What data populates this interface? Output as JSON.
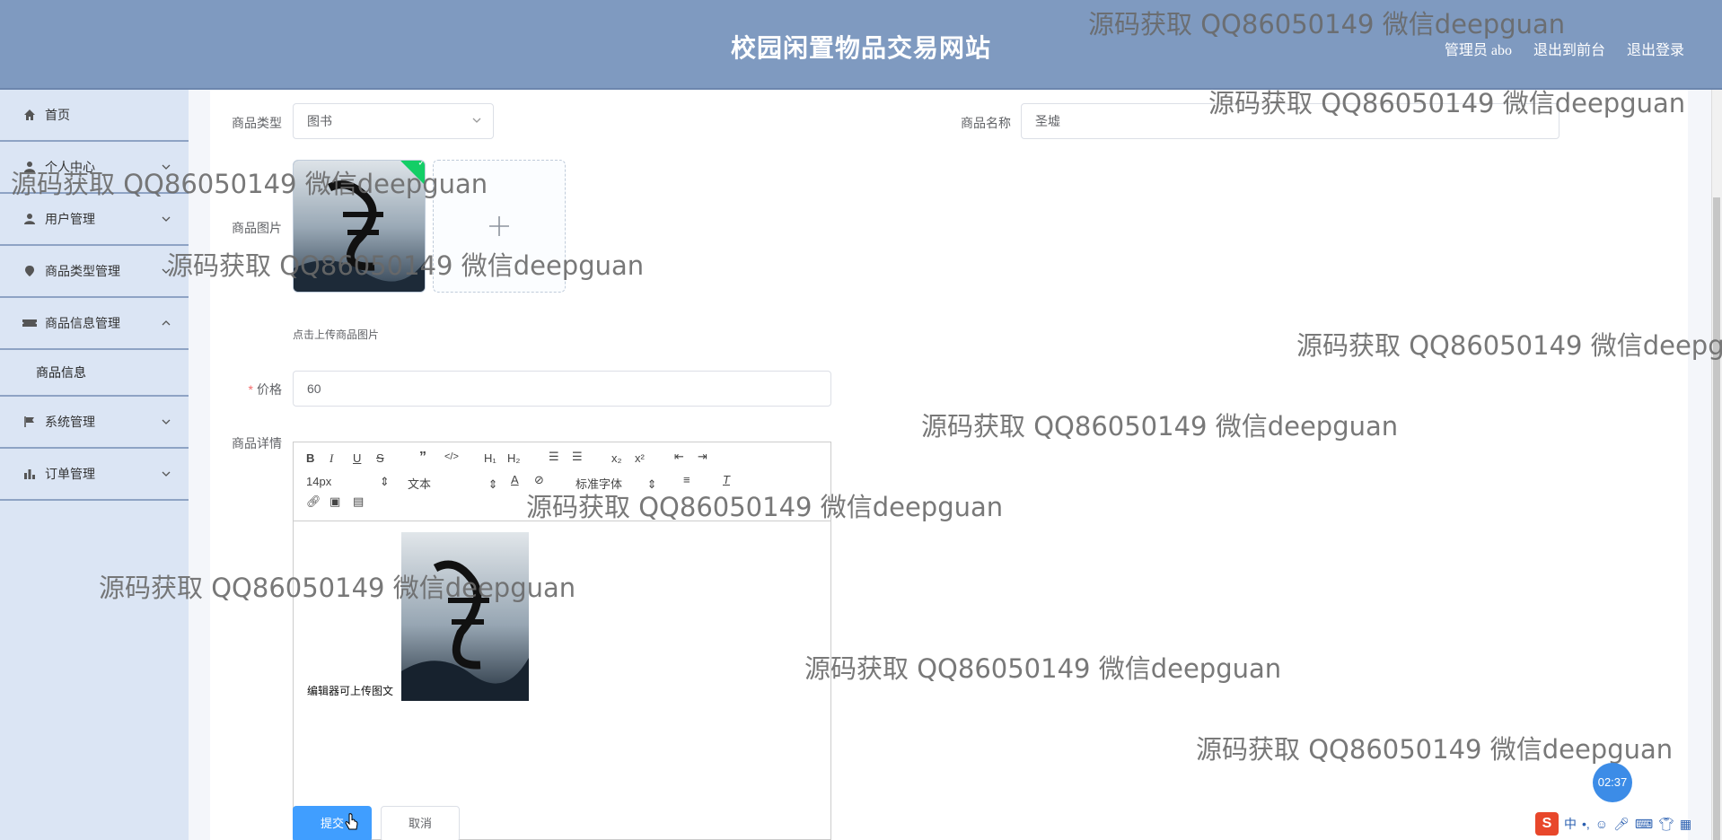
{
  "header": {
    "title": "校园闲置物品交易网站",
    "admin": "管理员 abo",
    "to_front": "退出到前台",
    "logout": "退出登录"
  },
  "sidebar": {
    "items": [
      {
        "label": "首页",
        "icon": "home-icon"
      },
      {
        "label": "个人中心",
        "icon": "user-icon"
      },
      {
        "label": "用户管理",
        "icon": "user-icon"
      },
      {
        "label": "商品类型管理",
        "icon": "location-icon"
      },
      {
        "label": "商品信息管理",
        "icon": "ticket-icon"
      },
      {
        "label": "系统管理",
        "icon": "flag-icon"
      },
      {
        "label": "订单管理",
        "icon": "bar-chart-icon"
      }
    ],
    "sub_item": "商品信息"
  },
  "form": {
    "type_label": "商品类型",
    "type_value": "图书",
    "name_label": "商品名称",
    "name_value": "圣墟",
    "image_label": "商品图片",
    "upload_hint": "点击上传商品图片",
    "price_required": "*",
    "price_label": "价格",
    "price_value": "60",
    "detail_label": "商品详情",
    "submit": "提交",
    "cancel": "取消"
  },
  "editor": {
    "font_size": "14px",
    "paragraph": "文本",
    "font_family": "标准字体",
    "text": "编辑器可上传图文"
  },
  "watermark": "源码获取 QQ86050149 微信deepguan",
  "timer": "02:37",
  "ime": {
    "logo": "S",
    "mode": "中"
  },
  "colors": {
    "header": "#7f9ac0",
    "sidebar": "#dbe5f4",
    "primary": "#409eff",
    "success": "#13ce66"
  }
}
